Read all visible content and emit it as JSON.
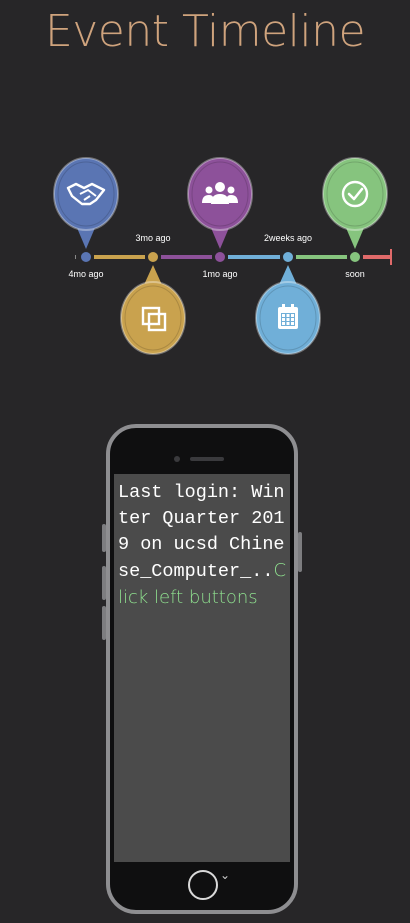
{
  "page": {
    "title": "Event Timeline"
  },
  "timeline": {
    "events": [
      {
        "label": "4mo ago",
        "icon": "handshake-icon",
        "color": "#5a75b3",
        "position": "above"
      },
      {
        "label": "3mo ago",
        "icon": "crop-icon",
        "color": "#c9a24e",
        "position": "below"
      },
      {
        "label": "1mo ago",
        "icon": "users-icon",
        "color": "#8d519a",
        "position": "above"
      },
      {
        "label": "2weeks ago",
        "icon": "calendar-icon",
        "color": "#70afd8",
        "position": "below"
      },
      {
        "label": "soon",
        "icon": "check-icon",
        "color": "#86c47e",
        "position": "above"
      }
    ],
    "end_color": "#e06a6a"
  },
  "phone": {
    "terminal_text": "Last login: Winter Quarter 2019 on ucsd Chinese_Computer_..",
    "hint_text": "Click left buttons",
    "home_arrow": "⌄"
  }
}
